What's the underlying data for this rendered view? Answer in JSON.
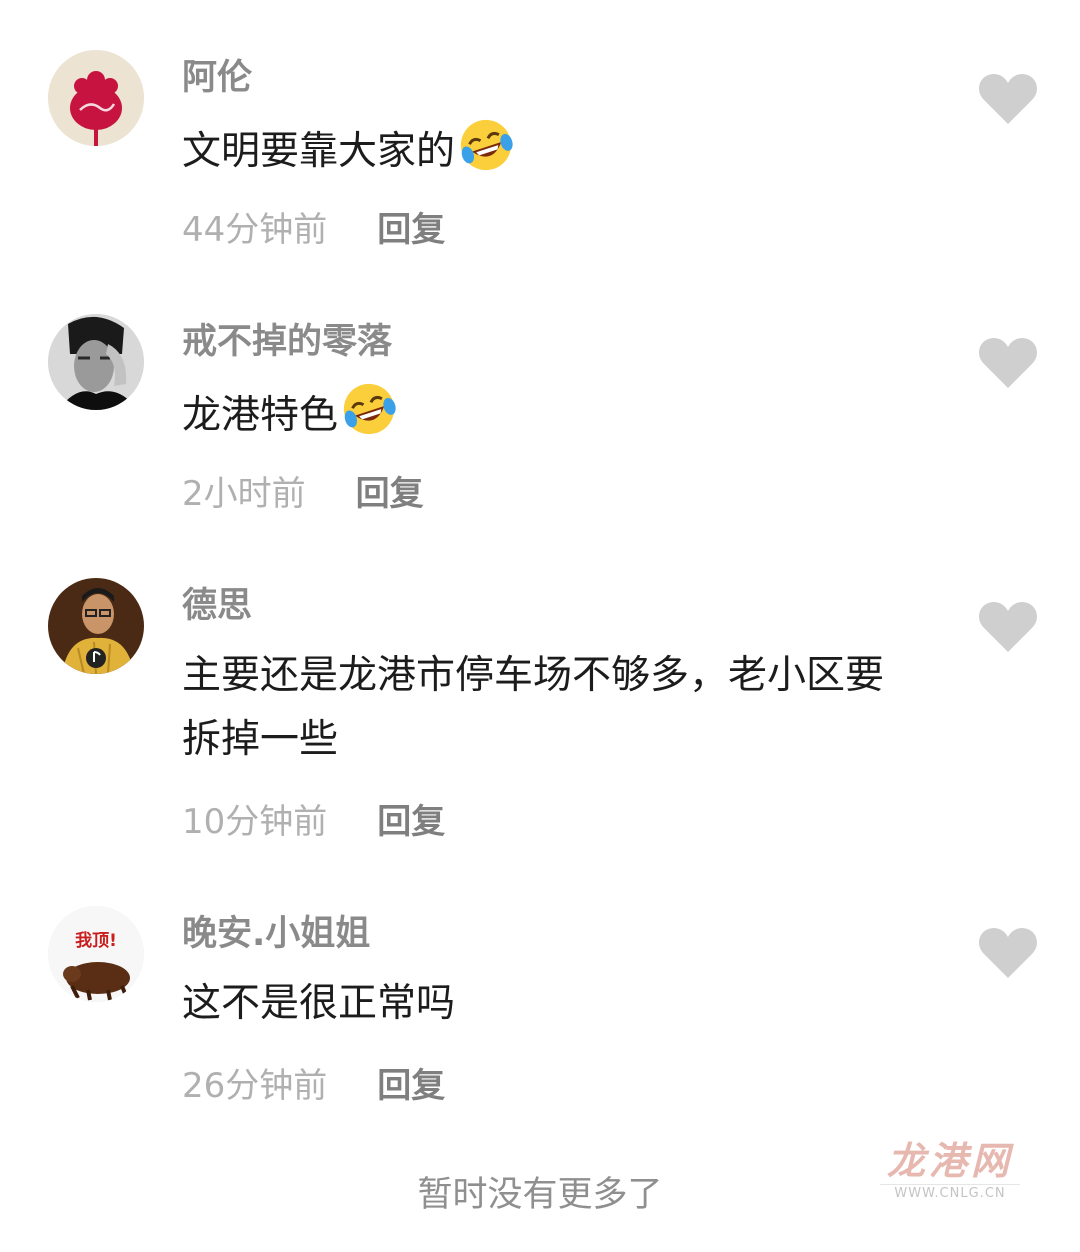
{
  "comments": [
    {
      "avatar": "red-flower-avatar",
      "username": "阿伦",
      "text": "文明要靠大家的",
      "emoji": "laughing-crying-emoji",
      "time": "44分钟前",
      "reply": "回复"
    },
    {
      "avatar": "portrait-avatar",
      "username": "戒不掉的零落",
      "text": "龙港特色",
      "emoji": "laughing-crying-emoji",
      "time": "2小时前",
      "reply": "回复"
    },
    {
      "avatar": "man-portrait-avatar",
      "username": "德思",
      "text": "主要还是龙港市停车场不够多，老小区要拆掉一些",
      "time": "10分钟前",
      "reply": "回复"
    },
    {
      "avatar": "bear-avatar",
      "avatar_text": "我顶!",
      "username": "晚安.小姐姐",
      "text": "这不是很正常吗",
      "time": "26分钟前",
      "reply": "回复"
    }
  ],
  "footer": {
    "text": "暂时没有更多了"
  },
  "watermark": {
    "title": "龙港网",
    "url": "WWW.CNLG.CN"
  },
  "colors": {
    "username": "#8a8a8a",
    "time": "#b0b0b0",
    "reply": "#7f7f7f",
    "like_heart": "#cfcfcf"
  },
  "icons": {
    "like": "heart-icon"
  }
}
